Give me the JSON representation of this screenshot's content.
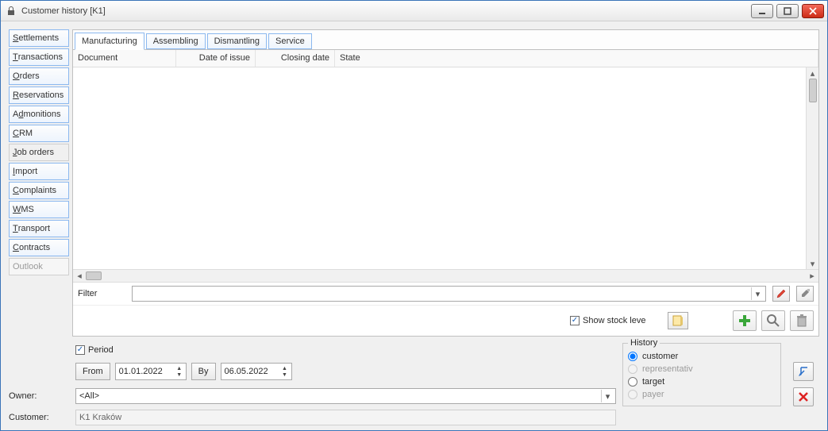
{
  "window": {
    "title": "Customer history [K1]"
  },
  "sidenav": {
    "items": [
      {
        "label": "Settlements",
        "u": 0
      },
      {
        "label": "Transactions",
        "u": 0
      },
      {
        "label": "Orders",
        "u": 0
      },
      {
        "label": "Reservations",
        "u": 0
      },
      {
        "label": "Admonitions",
        "u": 1
      },
      {
        "label": "CRM",
        "u": 0
      },
      {
        "label": "Job orders",
        "u": 0,
        "selected": true
      },
      {
        "label": "Import",
        "u": 0
      },
      {
        "label": "Complaints",
        "u": 0
      },
      {
        "label": "WMS",
        "u": 0
      },
      {
        "label": "Transport",
        "u": 0
      },
      {
        "label": "Contracts",
        "u": 0
      },
      {
        "label": "Outlook",
        "u": -1,
        "disabled": true
      }
    ]
  },
  "tabs": [
    {
      "label": "Manufacturing",
      "active": true
    },
    {
      "label": "Assembling"
    },
    {
      "label": "Dismantling"
    },
    {
      "label": "Service"
    }
  ],
  "grid": {
    "columns": [
      "Document",
      "Date of issue",
      "Closing date",
      "State"
    ]
  },
  "filter": {
    "label": "Filter"
  },
  "stock": {
    "label": "Show stock leve",
    "checked": true
  },
  "period": {
    "label": "Period",
    "checked": true,
    "from_btn": "From",
    "from_date": "01.01.2022",
    "by_btn": "By",
    "to_date": "06.05.2022"
  },
  "owner": {
    "label": "Owner:",
    "value": "<All>"
  },
  "customer": {
    "label": "Customer:",
    "value": "K1 Kraków"
  },
  "history": {
    "legend": "History",
    "customer": "customer",
    "representative": "representativ",
    "target": "target",
    "payer": "payer",
    "selected": "customer"
  }
}
